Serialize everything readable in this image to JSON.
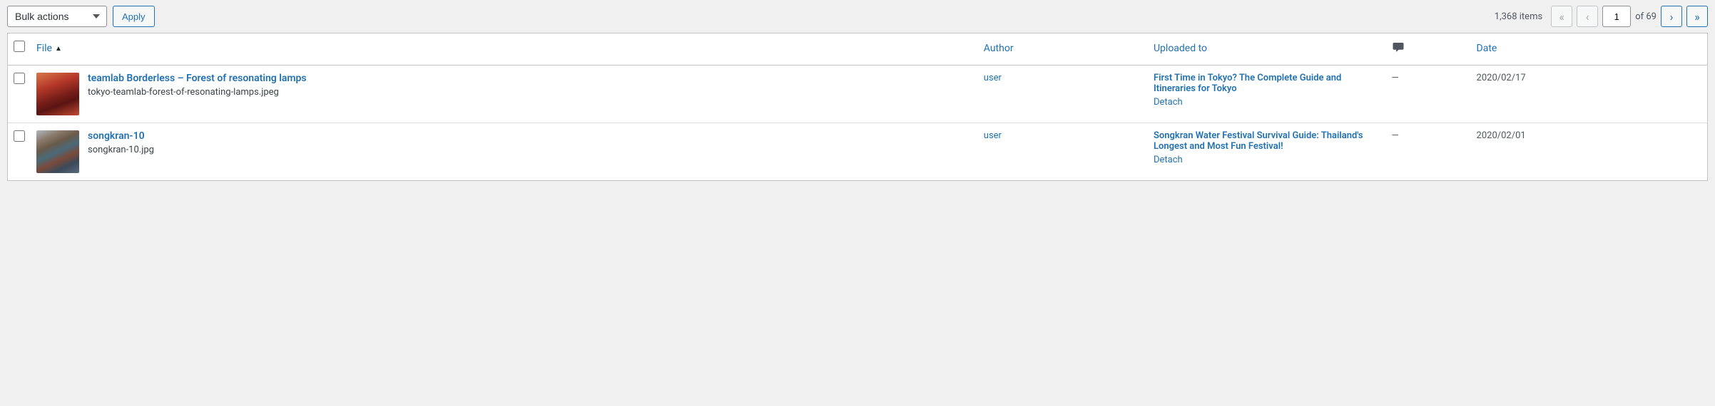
{
  "bulk_actions": {
    "label": "Bulk actions",
    "apply_label": "Apply"
  },
  "pagination": {
    "items_label": "1,368 items",
    "current_page": "1",
    "of_label": "of",
    "total_pages": "69"
  },
  "columns": {
    "file": "File",
    "author": "Author",
    "uploaded_to": "Uploaded to",
    "date": "Date"
  },
  "rows": [
    {
      "title": "teamlab Borderless – Forest of resonating lamps",
      "filename": "tokyo-teamlab-forest-of-resonating-lamps.jpeg",
      "author": "user",
      "uploaded_to": "First Time in Tokyo? The Complete Guide and Itineraries for Tokyo",
      "detach": "Detach",
      "comments": "—",
      "date": "2020/02/17",
      "thumb_class": "lamps"
    },
    {
      "title": "songkran-10",
      "filename": "songkran-10.jpg",
      "author": "user",
      "uploaded_to": "Songkran Water Festival Survival Guide: Thailand's Longest and Most Fun Festival!",
      "detach": "Detach",
      "comments": "—",
      "date": "2020/02/01",
      "thumb_class": "songkran"
    }
  ]
}
